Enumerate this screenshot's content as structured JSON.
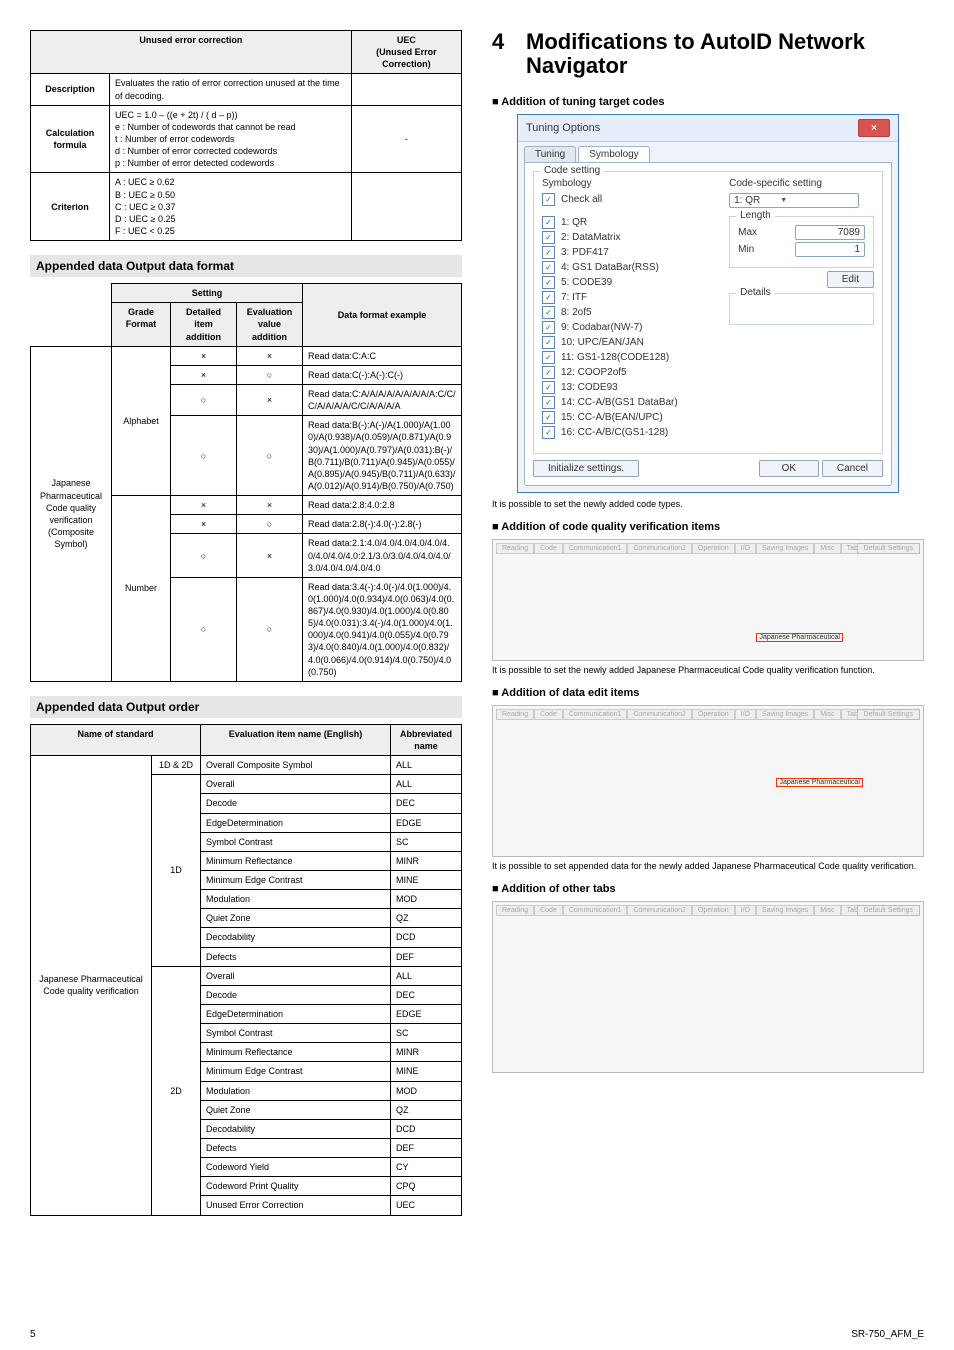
{
  "page": {
    "num": "5",
    "code": "SR-750_AFM_E"
  },
  "uec": {
    "head1": "Unused error correction",
    "head2": "UEC\n(Unused Error Correction)",
    "rows": [
      {
        "label": "Description",
        "c1": "Evaluates the ratio of error correction unused at the time of decoding.",
        "c2": ""
      },
      {
        "label": "Calculation formula",
        "c1": "UEC = 1.0 – ((e + 2t) / ( d – p))\ne : Number of codewords that cannot be read\nt : Number of error codewords\nd : Number of error corrected codewords\np : Number of error detected codewords",
        "c2": "-"
      },
      {
        "label": "Criterion",
        "c1": "A : UEC ≥ 0.62\nB : UEC ≥ 0.50\nC : UEC ≥ 0.37\nD : UEC ≥ 0.25\nF : UEC < 0.25",
        "c2": ""
      }
    ]
  },
  "sec1": "Appended data  Output data format",
  "setting": {
    "h": {
      "setting": "Setting",
      "gf": "Grade Format",
      "di": "Detailed item addition",
      "ev": "Evaluation value addition",
      "dfe": "Data format example"
    },
    "leftTop": "Japanese Pharmaceutical Code quality verification (Composite Symbol)",
    "alphabet": "Alphabet",
    "number": "Number",
    "rowsA": [
      {
        "di": "×",
        "ev": "×",
        "d": "Read data:C:A:C"
      },
      {
        "di": "×",
        "ev": "○",
        "d": "Read data:C(-):A(-):C(-)"
      },
      {
        "di": "○",
        "ev": "×",
        "d": "Read data:C:A/A/A/A/A/A/A/A/A:C/C/C/A/A/A/A/C/C/A/A/A/A"
      },
      {
        "di": "○",
        "ev": "○",
        "d": "Read data:B(-):A(-)/A(1.000)/A(1.000)/A(0.938)/A(0.059)/A(0.871)/A(0.930)/A(1.000)/A(0.797)/A(0.031):B(-)/B(0.711)/B(0.711)/A(0.945)/A(0.055)/A(0.895)/A(0.945)/B(0.711)/A(0.633)/A(0.012)/A(0.914)/B(0.750)/A(0.750)"
      }
    ],
    "rowsN": [
      {
        "di": "×",
        "ev": "×",
        "d": "Read data:2.8:4.0:2.8"
      },
      {
        "di": "×",
        "ev": "○",
        "d": "Read data:2.8(-):4.0(-):2.8(-)"
      },
      {
        "di": "○",
        "ev": "×",
        "d": "Read data:2.1:4.0/4.0/4.0/4.0/4.0/4.0/4.0/4.0/4.0:2.1/3.0/3.0/4.0/4.0/4.0/3.0/4.0/4.0/4.0/4.0"
      },
      {
        "di": "○",
        "ev": "○",
        "d": "Read data:3.4(-):4.0(-)/4.0(1.000)/4.0(1.000)/4.0(0.934)/4.0(0.063)/4.0(0.867)/4.0(0.930)/4.0(1.000)/4.0(0.805)/4.0(0.031):3.4(-)/4.0(1.000)/4.0(1.000)/4.0(0.941)/4.0(0.055)/4.0(0.793)/4.0(0.840)/4.0(1.000)/4.0(0.832)/4.0(0.066)/4.0(0.914)/4.0(0.750)/4.0(0.750)"
      }
    ]
  },
  "sec2": "Appended data  Output order",
  "order": {
    "h": {
      "name": "Name of standard",
      "eval": "Evaluation item name (English)",
      "abbr": "Abbreviated name"
    },
    "leftTop": "Japanese Pharmaceutical Code quality verification",
    "combined": {
      "g": "1D & 2D",
      "n": "Overall Composite Symbol",
      "a": "ALL"
    },
    "g1": "1D",
    "g2": "2D",
    "rows1": [
      {
        "n": "Overall",
        "a": "ALL"
      },
      {
        "n": "Decode",
        "a": "DEC"
      },
      {
        "n": "EdgeDetermination",
        "a": "EDGE"
      },
      {
        "n": "Symbol Contrast",
        "a": "SC"
      },
      {
        "n": "Minimum Reflectance",
        "a": "MINR"
      },
      {
        "n": "Minimum Edge Contrast",
        "a": "MINE"
      },
      {
        "n": "Modulation",
        "a": "MOD"
      },
      {
        "n": "Quiet Zone",
        "a": "QZ"
      },
      {
        "n": "Decodability",
        "a": "DCD"
      },
      {
        "n": "Defects",
        "a": "DEF"
      }
    ],
    "rows2": [
      {
        "n": "Overall",
        "a": "ALL"
      },
      {
        "n": "Decode",
        "a": "DEC"
      },
      {
        "n": "EdgeDetermination",
        "a": "EDGE"
      },
      {
        "n": "Symbol Contrast",
        "a": "SC"
      },
      {
        "n": "Minimum Reflectance",
        "a": "MINR"
      },
      {
        "n": "Minimum Edge Contrast",
        "a": "MINE"
      },
      {
        "n": "Modulation",
        "a": "MOD"
      },
      {
        "n": "Quiet Zone",
        "a": "QZ"
      },
      {
        "n": "Decodability",
        "a": "DCD"
      },
      {
        "n": "Defects",
        "a": "DEF"
      },
      {
        "n": "Codeword Yield",
        "a": "CY"
      },
      {
        "n": "Codeword Print Quality",
        "a": "CPQ"
      },
      {
        "n": "Unused Error Correction",
        "a": "UEC"
      }
    ]
  },
  "right": {
    "title": "Modifications to AutoID Network Navigator",
    "chapNum": "4",
    "s1": "■ Addition of tuning target codes",
    "s1cap": "It is possible to set the newly added code types.",
    "s2": "■ Addition of code quality verification items",
    "s2cap": "It is possible to set the newly added Japanese Pharmaceutical Code quality verification function.",
    "s3": "■ Addition of data edit items",
    "s3cap": "It is possible to set appended data for the newly added Japanese Pharmaceutical Code quality verification.",
    "s4": "■ Addition of other tabs"
  },
  "tun": {
    "title": "Tuning Options",
    "tab1": "Tuning",
    "tab2": "Symbology",
    "codeSetting": "Code setting",
    "symb": "Symbology",
    "css": "Code-specific setting",
    "checkall": "Check all",
    "sel": "1: QR",
    "length": "Length",
    "max": "Max",
    "min": "Min",
    "maxv": "7089",
    "minv": "1",
    "edit": "Edit",
    "details": "Details",
    "init": "Initialize settings.",
    "ok": "OK",
    "cancel": "Cancel",
    "list": [
      "1: QR",
      "2: DataMatrix",
      "3: PDF417",
      "4: GS1 DataBar(RSS)",
      "5: CODE39",
      "7: ITF",
      "8: 2of5",
      "9: Codabar(NW-7)",
      "10: UPC/EAN/JAN",
      "11: GS1-128(CODE128)",
      "12: COOP2of5",
      "13: CODE93",
      "14: CC-A/B(GS1 DataBar)",
      "15: CC-A/B(EAN/UPC)",
      "16: CC-A/B/C(GS1-128)"
    ]
  },
  "mini": {
    "tabs": [
      "Reading",
      "Code",
      "Communication1",
      "Communication2",
      "Operation",
      "I/O",
      "Saving Images",
      "Misc",
      "Table"
    ],
    "defset": "Default Settings",
    "hl_quality": "Japanese Pharmaceutical",
    "hl_edit": "Japanese Pharmaceutical"
  }
}
